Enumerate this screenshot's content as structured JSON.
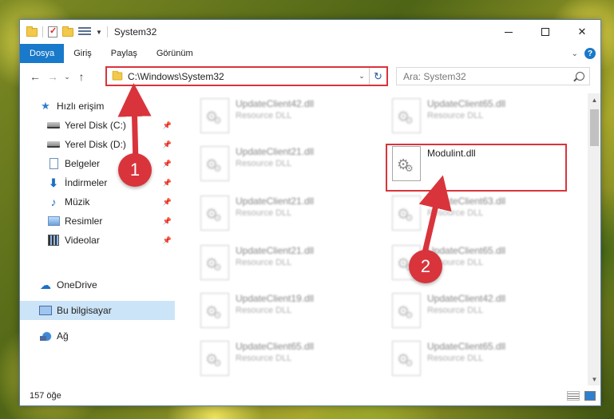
{
  "window": {
    "title": "System32",
    "controls": {
      "minimize": "",
      "maximize": "",
      "close": "✕"
    }
  },
  "ribbon": {
    "tabs": [
      "Dosya",
      "Giriş",
      "Paylaş",
      "Görünüm"
    ],
    "active_tab": "Dosya",
    "help_label": "?"
  },
  "address": {
    "path": "C:\\Windows\\System32",
    "search_placeholder": "Ara: System32"
  },
  "sidebar": {
    "items": [
      {
        "label": "Hızlı erişim",
        "icon": "star-icon",
        "pinned": false
      },
      {
        "label": "Yerel Disk (C:)",
        "icon": "drive-icon",
        "pinned": true
      },
      {
        "label": "Yerel Disk (D:)",
        "icon": "drive-icon",
        "pinned": true
      },
      {
        "label": "Belgeler",
        "icon": "document-icon",
        "pinned": true
      },
      {
        "label": "İndirmeler",
        "icon": "download-icon",
        "pinned": true
      },
      {
        "label": "Müzik",
        "icon": "music-icon",
        "pinned": true
      },
      {
        "label": "Resimler",
        "icon": "pictures-icon",
        "pinned": true
      },
      {
        "label": "Videolar",
        "icon": "videos-icon",
        "pinned": true
      },
      {
        "label": "OneDrive",
        "icon": "cloud-icon",
        "pinned": false
      },
      {
        "label": "Bu bilgisayar",
        "icon": "computer-icon",
        "pinned": false,
        "selected": true
      },
      {
        "label": "Ağ",
        "icon": "network-icon",
        "pinned": false
      }
    ]
  },
  "files": {
    "left_column": [
      {
        "name": "UpdateClient42.dll",
        "type": "Resource DLL"
      },
      {
        "name": "UpdateClient21.dll",
        "type": "Resource DLL"
      },
      {
        "name": "UpdateClient21.dll",
        "type": "Resource DLL"
      },
      {
        "name": "UpdateClient21.dll",
        "type": "Resource DLL"
      },
      {
        "name": "UpdateClient19.dll",
        "type": "Resource DLL"
      },
      {
        "name": "UpdateClient65.dll",
        "type": "Resource DLL"
      }
    ],
    "right_column": [
      {
        "name": "UpdateClient65.dll",
        "type": "Resource DLL"
      },
      {
        "name": "Modulint.dll",
        "type": "",
        "highlighted": true
      },
      {
        "name": "UpdateClient63.dll",
        "type": "Resource DLL"
      },
      {
        "name": "UpdateClient65.dll",
        "type": "Resource DLL"
      },
      {
        "name": "UpdateClient42.dll",
        "type": "Resource DLL"
      },
      {
        "name": "UpdateClient65.dll",
        "type": "Resource DLL"
      }
    ]
  },
  "status": {
    "item_count": "157 öğe"
  },
  "annotations": [
    {
      "number": "1",
      "color": "#d9343b"
    },
    {
      "number": "2",
      "color": "#d9343b"
    }
  ],
  "colors": {
    "accent": "#1979ca",
    "annotation_red": "#d9343b",
    "selection": "#cce4f7"
  }
}
